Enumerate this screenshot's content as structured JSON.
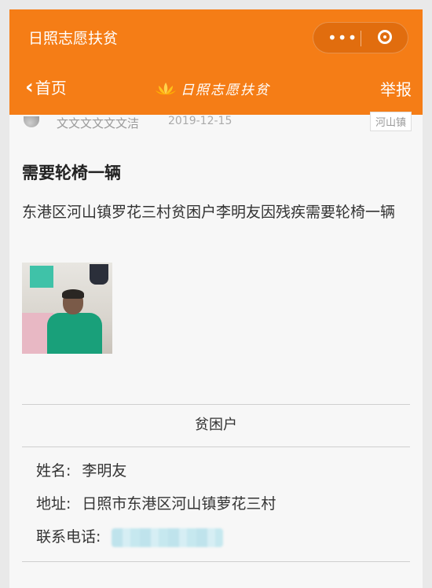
{
  "header": {
    "app_title": "日照志愿扶贫",
    "menu_icon": "more-dots-icon",
    "close_icon": "target-circle-icon"
  },
  "nav": {
    "back_label": "首页",
    "brand_text": "日照志愿扶贫",
    "report_label": "举报"
  },
  "post": {
    "author": "文文文文文文洁",
    "date": "2019-12-15",
    "town_tag": "河山镇",
    "title": "需要轮椅一辆",
    "description": "东港区河山镇罗花三村贫困户李明友因残疾需要轮椅一辆"
  },
  "household": {
    "section_title": "贫困户",
    "name_label": "姓名:",
    "name_value": "李明友",
    "address_label": "地址:",
    "address_value": "日照市东港区河山镇萝花三村",
    "phone_label": "联系电话:"
  },
  "colors": {
    "brand_orange": "#f57d16"
  }
}
